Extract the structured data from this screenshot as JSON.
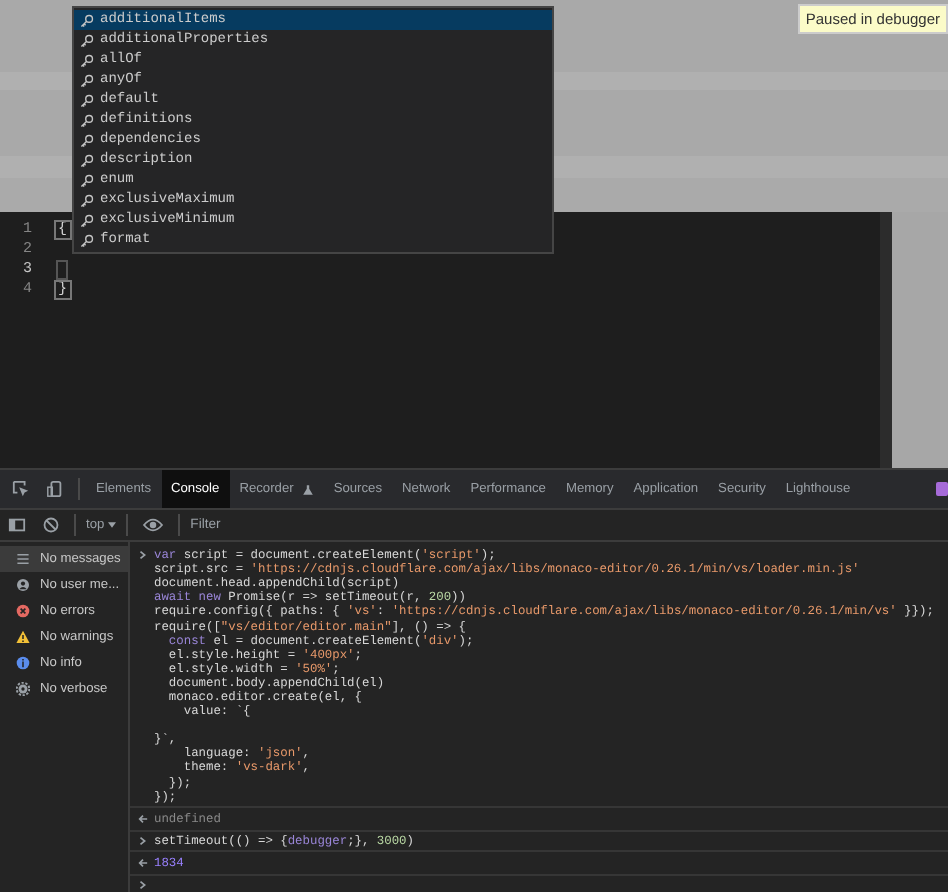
{
  "badge": {
    "text": "Paused in debugger"
  },
  "editor": {
    "lines": [
      {
        "number": "1",
        "text": "{",
        "current": false
      },
      {
        "number": "2",
        "current": false
      },
      {
        "number": "3",
        "current": true
      },
      {
        "number": "4",
        "text": "}",
        "current": false
      }
    ]
  },
  "suggestions": [
    {
      "label": "additionalItems",
      "selected": true
    },
    {
      "label": "additionalProperties",
      "selected": false
    },
    {
      "label": "allOf",
      "selected": false
    },
    {
      "label": "anyOf",
      "selected": false
    },
    {
      "label": "default",
      "selected": false
    },
    {
      "label": "definitions",
      "selected": false
    },
    {
      "label": "dependencies",
      "selected": false
    },
    {
      "label": "description",
      "selected": false
    },
    {
      "label": "enum",
      "selected": false
    },
    {
      "label": "exclusiveMaximum",
      "selected": false
    },
    {
      "label": "exclusiveMinimum",
      "selected": false
    },
    {
      "label": "format",
      "selected": false
    }
  ],
  "devtools": {
    "tabs": [
      {
        "label": "Elements",
        "selected": false,
        "kind": "plain"
      },
      {
        "label": "Console",
        "selected": true,
        "kind": "plain"
      },
      {
        "label": "Recorder",
        "selected": false,
        "kind": "flask"
      },
      {
        "label": "Sources",
        "selected": false,
        "kind": "plain"
      },
      {
        "label": "Network",
        "selected": false,
        "kind": "plain"
      },
      {
        "label": "Performance",
        "selected": false,
        "kind": "plain"
      },
      {
        "label": "Memory",
        "selected": false,
        "kind": "plain"
      },
      {
        "label": "Application",
        "selected": false,
        "kind": "plain"
      },
      {
        "label": "Security",
        "selected": false,
        "kind": "plain"
      },
      {
        "label": "Lighthouse",
        "selected": false,
        "kind": "plain"
      }
    ],
    "context": "top",
    "filter": {
      "placeholder": "Filter"
    },
    "sidebar": [
      {
        "label": "No messages",
        "kind": "list",
        "selected": true
      },
      {
        "label": "No user me...",
        "kind": "user",
        "selected": false
      },
      {
        "label": "No errors",
        "kind": "error",
        "selected": false
      },
      {
        "label": "No warnings",
        "kind": "warning",
        "selected": false
      },
      {
        "label": "No info",
        "kind": "info",
        "selected": false
      },
      {
        "label": "No verbose",
        "kind": "verbose",
        "selected": false
      }
    ],
    "console": [
      {
        "kind": "input",
        "lines": [
          {
            "segs": [
              {
                "color": "#9a86d8",
                "t": "var"
              },
              {
                "t": " script = document.createElement("
              },
              {
                "color": "#e8996a",
                "t": "'script'"
              },
              {
                "t": ");"
              }
            ]
          },
          {
            "segs": [
              {
                "t": "script.src = "
              },
              {
                "color": "#e8996a",
                "t": "'https://cdnjs.cloudflare.com/ajax/libs/monaco-editor/0.26.1/min/vs/loader.min.js'"
              }
            ]
          },
          {
            "segs": [
              {
                "t": "document.head.appendChild(script)"
              }
            ]
          },
          {
            "segs": [
              {
                "color": "#9a86d8",
                "t": "await new"
              },
              {
                "t": " Promise(r => setTimeout(r, "
              },
              {
                "color": "#b9d8a4",
                "t": "200"
              },
              {
                "t": "))"
              }
            ]
          },
          {
            "segs": [
              {
                "t": "require.config({ paths: { "
              },
              {
                "color": "#e8996a",
                "t": "'vs'"
              },
              {
                "t": ": "
              },
              {
                "color": "#e8996a",
                "t": "'https://cdnjs.cloudflare.com/ajax/libs/monaco-editor/0.26.1/min/vs'"
              },
              {
                "t": " }});"
              }
            ]
          },
          {
            "segs": [
              {
                "t": "require(["
              },
              {
                "color": "#e8996a",
                "t": "\"vs/editor/editor.main\""
              },
              {
                "t": "], () => {"
              }
            ]
          },
          {
            "segs": [
              {
                "color": "#9a86d8",
                "t": "  const"
              },
              {
                "t": " el = document.createElement("
              },
              {
                "color": "#e8996a",
                "t": "'div'"
              },
              {
                "t": ");"
              }
            ]
          },
          {
            "segs": [
              {
                "t": "  el.style.height = "
              },
              {
                "color": "#e8996a",
                "t": "'400px'"
              },
              {
                "t": ";"
              }
            ]
          },
          {
            "segs": [
              {
                "t": "  el.style.width = "
              },
              {
                "color": "#e8996a",
                "t": "'50%'"
              },
              {
                "t": ";"
              }
            ]
          },
          {
            "segs": [
              {
                "t": "  document.body.appendChild(el)"
              }
            ]
          },
          {
            "segs": [
              {
                "t": "  monaco.editor.create(el, {"
              }
            ]
          },
          {
            "segs": [
              {
                "t": "    value: `{"
              }
            ]
          },
          {
            "segs": [
              {
                "t": "}`,"
              }
            ],
            "gap_before": true
          },
          {
            "segs": [
              {
                "t": "    language: "
              },
              {
                "color": "#e8996a",
                "t": "'json'"
              },
              {
                "t": ","
              }
            ]
          },
          {
            "segs": [
              {
                "t": "    theme: "
              },
              {
                "color": "#e8996a",
                "t": "'vs-dark'"
              },
              {
                "t": ","
              }
            ]
          },
          {
            "segs": [
              {
                "t": "  });"
              }
            ]
          },
          {
            "segs": [
              {
                "t": "});"
              }
            ]
          }
        ]
      },
      {
        "kind": "result",
        "text": "undefined",
        "muted": true
      },
      {
        "kind": "input",
        "lines": [
          {
            "segs": [
              {
                "t": "setTimeout(() => {"
              },
              {
                "color": "#9a86d8",
                "t": "debugger"
              },
              {
                "t": ";}, "
              },
              {
                "color": "#b9d8a4",
                "t": "3000"
              },
              {
                "t": ")"
              }
            ]
          }
        ]
      },
      {
        "kind": "result",
        "text": "1834",
        "muted": false
      },
      {
        "kind": "prompt"
      }
    ]
  }
}
